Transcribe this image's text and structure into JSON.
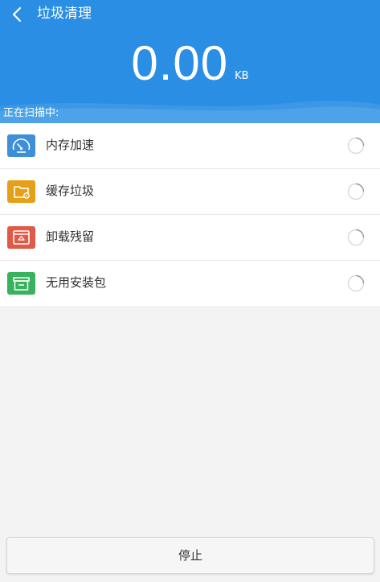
{
  "header": {
    "title": "垃圾清理",
    "size_value": "0.00",
    "size_unit": "KB",
    "scan_label": "正在扫描中:"
  },
  "items": [
    {
      "label": "内存加速",
      "icon": "speedometer-icon",
      "color": "#3d8fd8"
    },
    {
      "label": "缓存垃圾",
      "icon": "folder-icon",
      "color": "#e5a018"
    },
    {
      "label": "卸载残留",
      "icon": "recycle-icon",
      "color": "#e05a48"
    },
    {
      "label": "无用安装包",
      "icon": "package-icon",
      "color": "#38b25d"
    }
  ],
  "footer": {
    "stop_label": "停止"
  },
  "colors": {
    "header_blue": "#2a8ee4",
    "background": "#f3f3f3"
  }
}
